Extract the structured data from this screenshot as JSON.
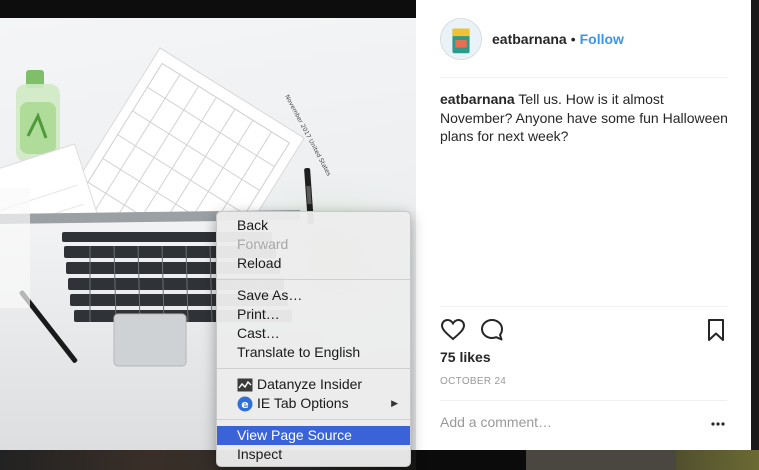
{
  "post": {
    "username": "eatbarnana",
    "separator": "•",
    "follow_label": "Follow",
    "caption_username": "eatbarnana",
    "caption_text": " Tell us. How is it almost November? Anyone have some fun Halloween plans for next week?",
    "likes": "75 likes",
    "date": "OCTOBER 24",
    "comment_placeholder": "Add a comment…",
    "more_icon": "ellipsis-icon",
    "accent_color": "#3897f0"
  },
  "photo": {
    "calendar_title": "November 2017 United States"
  },
  "context_menu": {
    "groups": [
      [
        {
          "label": "Back",
          "enabled": true
        },
        {
          "label": "Forward",
          "enabled": false
        },
        {
          "label": "Reload",
          "enabled": true
        }
      ],
      [
        {
          "label": "Save As…",
          "enabled": true
        },
        {
          "label": "Print…",
          "enabled": true
        },
        {
          "label": "Cast…",
          "enabled": true
        },
        {
          "label": "Translate to English",
          "enabled": true
        }
      ],
      [
        {
          "label": "Datanyze Insider",
          "enabled": true,
          "icon": "datanyze-chart-icon"
        },
        {
          "label": "IE Tab Options",
          "enabled": true,
          "icon": "ie-tab-icon",
          "submenu": true
        }
      ],
      [
        {
          "label": "View Page Source",
          "enabled": true,
          "highlighted": true
        },
        {
          "label": "Inspect",
          "enabled": true
        }
      ]
    ],
    "highlight_color": "#3b63d8"
  }
}
